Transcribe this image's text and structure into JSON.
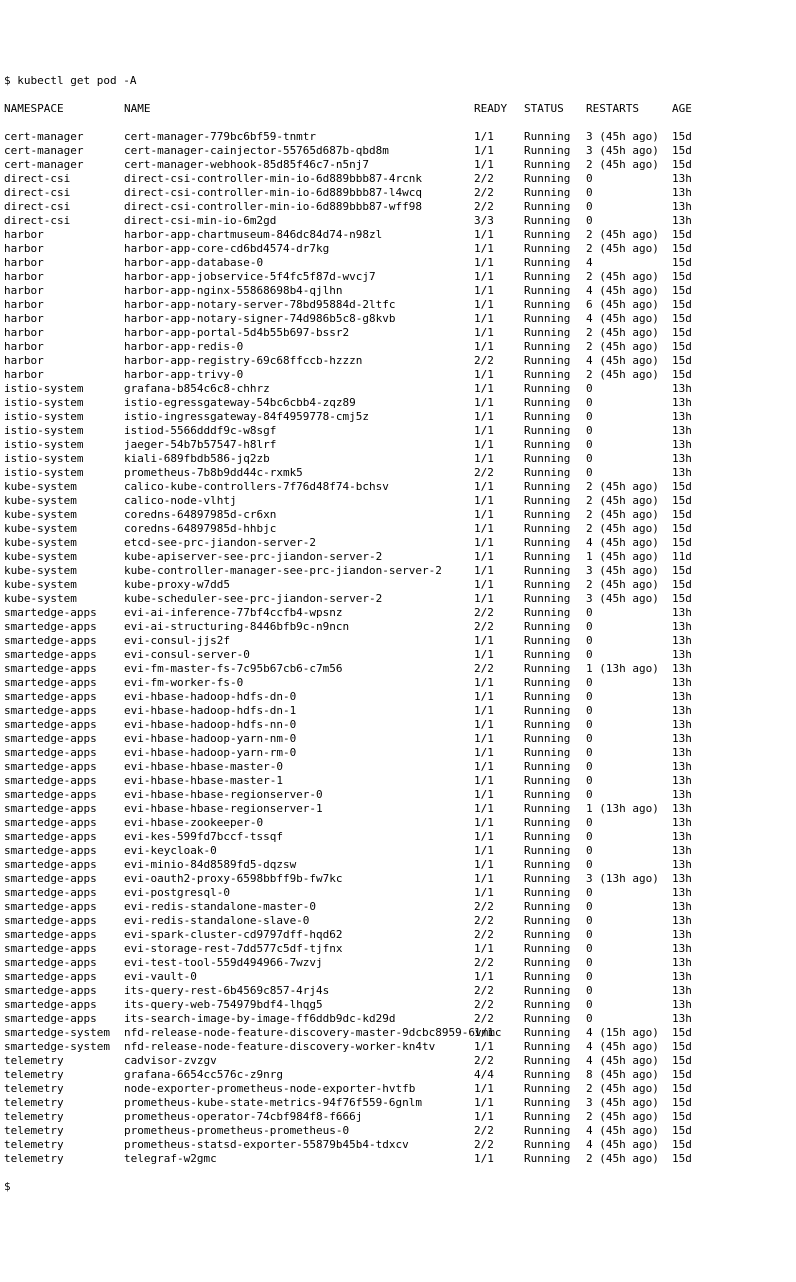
{
  "prompt_symbol": "$",
  "command": "kubectl get pod -A",
  "end_prompt": "$",
  "headers": {
    "namespace": "NAMESPACE",
    "name": "NAME",
    "ready": "READY",
    "status": "STATUS",
    "restarts": "RESTARTS",
    "age": "AGE"
  },
  "rows": [
    {
      "ns": "cert-manager",
      "name": "cert-manager-779bc6bf59-tnmtr",
      "ready": "1/1",
      "status": "Running",
      "restarts": "3 (45h ago)",
      "age": "15d"
    },
    {
      "ns": "cert-manager",
      "name": "cert-manager-cainjector-55765d687b-qbd8m",
      "ready": "1/1",
      "status": "Running",
      "restarts": "3 (45h ago)",
      "age": "15d"
    },
    {
      "ns": "cert-manager",
      "name": "cert-manager-webhook-85d85f46c7-n5nj7",
      "ready": "1/1",
      "status": "Running",
      "restarts": "2 (45h ago)",
      "age": "15d"
    },
    {
      "ns": "direct-csi",
      "name": "direct-csi-controller-min-io-6d889bbb87-4rcnk",
      "ready": "2/2",
      "status": "Running",
      "restarts": "0",
      "age": "13h"
    },
    {
      "ns": "direct-csi",
      "name": "direct-csi-controller-min-io-6d889bbb87-l4wcq",
      "ready": "2/2",
      "status": "Running",
      "restarts": "0",
      "age": "13h"
    },
    {
      "ns": "direct-csi",
      "name": "direct-csi-controller-min-io-6d889bbb87-wff98",
      "ready": "2/2",
      "status": "Running",
      "restarts": "0",
      "age": "13h"
    },
    {
      "ns": "direct-csi",
      "name": "direct-csi-min-io-6m2gd",
      "ready": "3/3",
      "status": "Running",
      "restarts": "0",
      "age": "13h"
    },
    {
      "ns": "harbor",
      "name": "harbor-app-chartmuseum-846dc84d74-n98zl",
      "ready": "1/1",
      "status": "Running",
      "restarts": "2 (45h ago)",
      "age": "15d"
    },
    {
      "ns": "harbor",
      "name": "harbor-app-core-cd6bd4574-dr7kg",
      "ready": "1/1",
      "status": "Running",
      "restarts": "2 (45h ago)",
      "age": "15d"
    },
    {
      "ns": "harbor",
      "name": "harbor-app-database-0",
      "ready": "1/1",
      "status": "Running",
      "restarts": "4",
      "age": "15d"
    },
    {
      "ns": "harbor",
      "name": "harbor-app-jobservice-5f4fc5f87d-wvcj7",
      "ready": "1/1",
      "status": "Running",
      "restarts": "2 (45h ago)",
      "age": "15d"
    },
    {
      "ns": "harbor",
      "name": "harbor-app-nginx-55868698b4-qjlhn",
      "ready": "1/1",
      "status": "Running",
      "restarts": "4 (45h ago)",
      "age": "15d"
    },
    {
      "ns": "harbor",
      "name": "harbor-app-notary-server-78bd95884d-2ltfc",
      "ready": "1/1",
      "status": "Running",
      "restarts": "6 (45h ago)",
      "age": "15d"
    },
    {
      "ns": "harbor",
      "name": "harbor-app-notary-signer-74d986b5c8-g8kvb",
      "ready": "1/1",
      "status": "Running",
      "restarts": "4 (45h ago)",
      "age": "15d"
    },
    {
      "ns": "harbor",
      "name": "harbor-app-portal-5d4b55b697-bssr2",
      "ready": "1/1",
      "status": "Running",
      "restarts": "2 (45h ago)",
      "age": "15d"
    },
    {
      "ns": "harbor",
      "name": "harbor-app-redis-0",
      "ready": "1/1",
      "status": "Running",
      "restarts": "2 (45h ago)",
      "age": "15d"
    },
    {
      "ns": "harbor",
      "name": "harbor-app-registry-69c68ffccb-hzzzn",
      "ready": "2/2",
      "status": "Running",
      "restarts": "4 (45h ago)",
      "age": "15d"
    },
    {
      "ns": "harbor",
      "name": "harbor-app-trivy-0",
      "ready": "1/1",
      "status": "Running",
      "restarts": "2 (45h ago)",
      "age": "15d"
    },
    {
      "ns": "istio-system",
      "name": "grafana-b854c6c8-chhrz",
      "ready": "1/1",
      "status": "Running",
      "restarts": "0",
      "age": "13h"
    },
    {
      "ns": "istio-system",
      "name": "istio-egressgateway-54bc6cbb4-zqz89",
      "ready": "1/1",
      "status": "Running",
      "restarts": "0",
      "age": "13h"
    },
    {
      "ns": "istio-system",
      "name": "istio-ingressgateway-84f4959778-cmj5z",
      "ready": "1/1",
      "status": "Running",
      "restarts": "0",
      "age": "13h"
    },
    {
      "ns": "istio-system",
      "name": "istiod-5566dddf9c-w8sgf",
      "ready": "1/1",
      "status": "Running",
      "restarts": "0",
      "age": "13h"
    },
    {
      "ns": "istio-system",
      "name": "jaeger-54b7b57547-h8lrf",
      "ready": "1/1",
      "status": "Running",
      "restarts": "0",
      "age": "13h"
    },
    {
      "ns": "istio-system",
      "name": "kiali-689fbdb586-jq2zb",
      "ready": "1/1",
      "status": "Running",
      "restarts": "0",
      "age": "13h"
    },
    {
      "ns": "istio-system",
      "name": "prometheus-7b8b9dd44c-rxmk5",
      "ready": "2/2",
      "status": "Running",
      "restarts": "0",
      "age": "13h"
    },
    {
      "ns": "kube-system",
      "name": "calico-kube-controllers-7f76d48f74-bchsv",
      "ready": "1/1",
      "status": "Running",
      "restarts": "2 (45h ago)",
      "age": "15d"
    },
    {
      "ns": "kube-system",
      "name": "calico-node-vlhtj",
      "ready": "1/1",
      "status": "Running",
      "restarts": "2 (45h ago)",
      "age": "15d"
    },
    {
      "ns": "kube-system",
      "name": "coredns-64897985d-cr6xn",
      "ready": "1/1",
      "status": "Running",
      "restarts": "2 (45h ago)",
      "age": "15d"
    },
    {
      "ns": "kube-system",
      "name": "coredns-64897985d-hhbjc",
      "ready": "1/1",
      "status": "Running",
      "restarts": "2 (45h ago)",
      "age": "15d"
    },
    {
      "ns": "kube-system",
      "name": "etcd-see-prc-jiandon-server-2",
      "ready": "1/1",
      "status": "Running",
      "restarts": "4 (45h ago)",
      "age": "15d"
    },
    {
      "ns": "kube-system",
      "name": "kube-apiserver-see-prc-jiandon-server-2",
      "ready": "1/1",
      "status": "Running",
      "restarts": "1 (45h ago)",
      "age": "11d"
    },
    {
      "ns": "kube-system",
      "name": "kube-controller-manager-see-prc-jiandon-server-2",
      "ready": "1/1",
      "status": "Running",
      "restarts": "3 (45h ago)",
      "age": "15d"
    },
    {
      "ns": "kube-system",
      "name": "kube-proxy-w7dd5",
      "ready": "1/1",
      "status": "Running",
      "restarts": "2 (45h ago)",
      "age": "15d"
    },
    {
      "ns": "kube-system",
      "name": "kube-scheduler-see-prc-jiandon-server-2",
      "ready": "1/1",
      "status": "Running",
      "restarts": "3 (45h ago)",
      "age": "15d"
    },
    {
      "ns": "smartedge-apps",
      "name": "evi-ai-inference-77bf4ccfb4-wpsnz",
      "ready": "2/2",
      "status": "Running",
      "restarts": "0",
      "age": "13h"
    },
    {
      "ns": "smartedge-apps",
      "name": "evi-ai-structuring-8446bfb9c-n9ncn",
      "ready": "2/2",
      "status": "Running",
      "restarts": "0",
      "age": "13h"
    },
    {
      "ns": "smartedge-apps",
      "name": "evi-consul-jjs2f",
      "ready": "1/1",
      "status": "Running",
      "restarts": "0",
      "age": "13h"
    },
    {
      "ns": "smartedge-apps",
      "name": "evi-consul-server-0",
      "ready": "1/1",
      "status": "Running",
      "restarts": "0",
      "age": "13h"
    },
    {
      "ns": "smartedge-apps",
      "name": "evi-fm-master-fs-7c95b67cb6-c7m56",
      "ready": "2/2",
      "status": "Running",
      "restarts": "1 (13h ago)",
      "age": "13h"
    },
    {
      "ns": "smartedge-apps",
      "name": "evi-fm-worker-fs-0",
      "ready": "1/1",
      "status": "Running",
      "restarts": "0",
      "age": "13h"
    },
    {
      "ns": "smartedge-apps",
      "name": "evi-hbase-hadoop-hdfs-dn-0",
      "ready": "1/1",
      "status": "Running",
      "restarts": "0",
      "age": "13h"
    },
    {
      "ns": "smartedge-apps",
      "name": "evi-hbase-hadoop-hdfs-dn-1",
      "ready": "1/1",
      "status": "Running",
      "restarts": "0",
      "age": "13h"
    },
    {
      "ns": "smartedge-apps",
      "name": "evi-hbase-hadoop-hdfs-nn-0",
      "ready": "1/1",
      "status": "Running",
      "restarts": "0",
      "age": "13h"
    },
    {
      "ns": "smartedge-apps",
      "name": "evi-hbase-hadoop-yarn-nm-0",
      "ready": "1/1",
      "status": "Running",
      "restarts": "0",
      "age": "13h"
    },
    {
      "ns": "smartedge-apps",
      "name": "evi-hbase-hadoop-yarn-rm-0",
      "ready": "1/1",
      "status": "Running",
      "restarts": "0",
      "age": "13h"
    },
    {
      "ns": "smartedge-apps",
      "name": "evi-hbase-hbase-master-0",
      "ready": "1/1",
      "status": "Running",
      "restarts": "0",
      "age": "13h"
    },
    {
      "ns": "smartedge-apps",
      "name": "evi-hbase-hbase-master-1",
      "ready": "1/1",
      "status": "Running",
      "restarts": "0",
      "age": "13h"
    },
    {
      "ns": "smartedge-apps",
      "name": "evi-hbase-hbase-regionserver-0",
      "ready": "1/1",
      "status": "Running",
      "restarts": "0",
      "age": "13h"
    },
    {
      "ns": "smartedge-apps",
      "name": "evi-hbase-hbase-regionserver-1",
      "ready": "1/1",
      "status": "Running",
      "restarts": "1 (13h ago)",
      "age": "13h"
    },
    {
      "ns": "smartedge-apps",
      "name": "evi-hbase-zookeeper-0",
      "ready": "1/1",
      "status": "Running",
      "restarts": "0",
      "age": "13h"
    },
    {
      "ns": "smartedge-apps",
      "name": "evi-kes-599fd7bccf-tssqf",
      "ready": "1/1",
      "status": "Running",
      "restarts": "0",
      "age": "13h"
    },
    {
      "ns": "smartedge-apps",
      "name": "evi-keycloak-0",
      "ready": "1/1",
      "status": "Running",
      "restarts": "0",
      "age": "13h"
    },
    {
      "ns": "smartedge-apps",
      "name": "evi-minio-84d8589fd5-dqzsw",
      "ready": "1/1",
      "status": "Running",
      "restarts": "0",
      "age": "13h"
    },
    {
      "ns": "smartedge-apps",
      "name": "evi-oauth2-proxy-6598bbff9b-fw7kc",
      "ready": "1/1",
      "status": "Running",
      "restarts": "3 (13h ago)",
      "age": "13h"
    },
    {
      "ns": "smartedge-apps",
      "name": "evi-postgresql-0",
      "ready": "1/1",
      "status": "Running",
      "restarts": "0",
      "age": "13h"
    },
    {
      "ns": "smartedge-apps",
      "name": "evi-redis-standalone-master-0",
      "ready": "2/2",
      "status": "Running",
      "restarts": "0",
      "age": "13h"
    },
    {
      "ns": "smartedge-apps",
      "name": "evi-redis-standalone-slave-0",
      "ready": "2/2",
      "status": "Running",
      "restarts": "0",
      "age": "13h"
    },
    {
      "ns": "smartedge-apps",
      "name": "evi-spark-cluster-cd9797dff-hqd62",
      "ready": "2/2",
      "status": "Running",
      "restarts": "0",
      "age": "13h"
    },
    {
      "ns": "smartedge-apps",
      "name": "evi-storage-rest-7dd577c5df-tjfnx",
      "ready": "1/1",
      "status": "Running",
      "restarts": "0",
      "age": "13h"
    },
    {
      "ns": "smartedge-apps",
      "name": "evi-test-tool-559d494966-7wzvj",
      "ready": "2/2",
      "status": "Running",
      "restarts": "0",
      "age": "13h"
    },
    {
      "ns": "smartedge-apps",
      "name": "evi-vault-0",
      "ready": "1/1",
      "status": "Running",
      "restarts": "0",
      "age": "13h"
    },
    {
      "ns": "smartedge-apps",
      "name": "its-query-rest-6b4569c857-4rj4s",
      "ready": "2/2",
      "status": "Running",
      "restarts": "0",
      "age": "13h"
    },
    {
      "ns": "smartedge-apps",
      "name": "its-query-web-754979bdf4-lhqg5",
      "ready": "2/2",
      "status": "Running",
      "restarts": "0",
      "age": "13h"
    },
    {
      "ns": "smartedge-apps",
      "name": "its-search-image-by-image-ff6ddb9dc-kd29d",
      "ready": "2/2",
      "status": "Running",
      "restarts": "0",
      "age": "13h"
    },
    {
      "ns": "smartedge-system",
      "name": "nfd-release-node-feature-discovery-master-9dcbc8959-6vmmc",
      "ready": "1/1",
      "status": "Running",
      "restarts": "4 (15h ago)",
      "age": "15d"
    },
    {
      "ns": "smartedge-system",
      "name": "nfd-release-node-feature-discovery-worker-kn4tv",
      "ready": "1/1",
      "status": "Running",
      "restarts": "4 (45h ago)",
      "age": "15d"
    },
    {
      "ns": "telemetry",
      "name": "cadvisor-zvzgv",
      "ready": "2/2",
      "status": "Running",
      "restarts": "4 (45h ago)",
      "age": "15d"
    },
    {
      "ns": "telemetry",
      "name": "grafana-6654cc576c-z9nrg",
      "ready": "4/4",
      "status": "Running",
      "restarts": "8 (45h ago)",
      "age": "15d"
    },
    {
      "ns": "telemetry",
      "name": "node-exporter-prometheus-node-exporter-hvtfb",
      "ready": "1/1",
      "status": "Running",
      "restarts": "2 (45h ago)",
      "age": "15d"
    },
    {
      "ns": "telemetry",
      "name": "prometheus-kube-state-metrics-94f76f559-6gnlm",
      "ready": "1/1",
      "status": "Running",
      "restarts": "3 (45h ago)",
      "age": "15d"
    },
    {
      "ns": "telemetry",
      "name": "prometheus-operator-74cbf984f8-f666j",
      "ready": "1/1",
      "status": "Running",
      "restarts": "2 (45h ago)",
      "age": "15d"
    },
    {
      "ns": "telemetry",
      "name": "prometheus-prometheus-prometheus-0",
      "ready": "2/2",
      "status": "Running",
      "restarts": "4 (45h ago)",
      "age": "15d"
    },
    {
      "ns": "telemetry",
      "name": "prometheus-statsd-exporter-55879b45b4-tdxcv",
      "ready": "2/2",
      "status": "Running",
      "restarts": "4 (45h ago)",
      "age": "15d"
    },
    {
      "ns": "telemetry",
      "name": "telegraf-w2gmc",
      "ready": "1/1",
      "status": "Running",
      "restarts": "2 (45h ago)",
      "age": "15d"
    }
  ]
}
